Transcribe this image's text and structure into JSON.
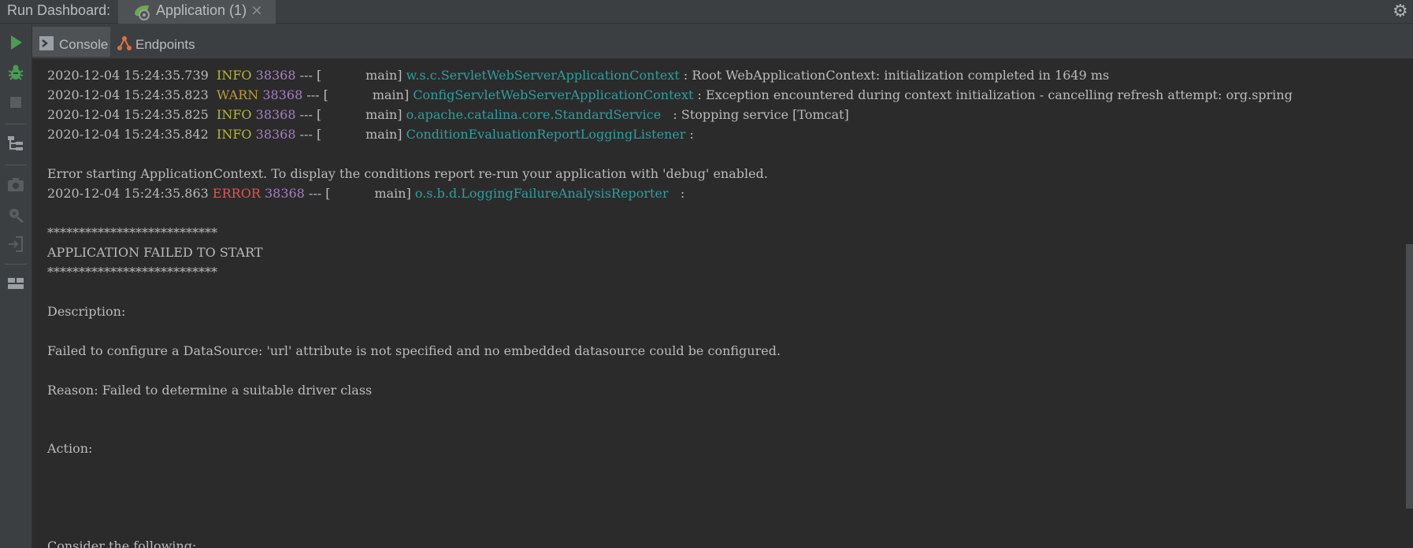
{
  "titlebar": {
    "title": "Run Dashboard:",
    "run_tab": "Application (1)",
    "close_glyph": "×",
    "icons": {
      "tab": "spring-boot-app-icon",
      "settings": "gear-icon"
    }
  },
  "toolbar": {
    "icons": [
      "run-icon",
      "debug-icon",
      "stop-icon",
      "tree-icon",
      "screenshot-icon",
      "settings-bug-icon",
      "login-icon",
      "layout-icon"
    ]
  },
  "console_tabs": [
    {
      "label": "Console",
      "icon": "console-icon",
      "active": true
    },
    {
      "label": "Endpoints",
      "icon": "endpoints-icon",
      "active": false
    }
  ],
  "colors": {
    "info": "#b6b63a",
    "warn": "#bb9c35",
    "error": "#e05555",
    "pid": "#a67fc4",
    "logger": "#2f9e9e",
    "text": "#bbbbbb"
  },
  "log_entries": [
    {
      "ts": "2020-12-04 15:24:35.739",
      "level": " INFO",
      "pid": "38368",
      "thread": " --- [           main] ",
      "logger": "w.s.c.ServletWebServerApplicationContext",
      "msg": " : Root WebApplicationContext: initialization completed in 1649 ms"
    },
    {
      "ts": "2020-12-04 15:24:35.823",
      "level": " WARN",
      "pid": "38368",
      "thread": " --- [           main] ",
      "logger": "ConfigServletWebServerApplicationContext",
      "msg": " : Exception encountered during context initialization - cancelling refresh attempt: org.spring"
    },
    {
      "ts": "2020-12-04 15:24:35.825",
      "level": " INFO",
      "pid": "38368",
      "thread": " --- [           main] ",
      "logger": "o.apache.catalina.core.StandardService  ",
      "msg": " : Stopping service [Tomcat]"
    },
    {
      "ts": "2020-12-04 15:24:35.842",
      "level": " INFO",
      "pid": "38368",
      "thread": " --- [           main] ",
      "logger": "ConditionEvaluationReportLoggingListener",
      "msg": " :"
    },
    {
      "ts": "2020-12-04 15:24:35.863",
      "level": "ERROR",
      "pid": "38368",
      "thread": " --- [           main] ",
      "logger": "o.s.b.d.LoggingFailureAnalysisReporter  ",
      "msg": " :"
    }
  ],
  "messages": {
    "error_starting": "Error starting ApplicationContext. To display the conditions report re-run your application with 'debug' enabled.",
    "stars": "***************************",
    "failed_title": "APPLICATION FAILED TO START",
    "description_label": "Description:",
    "description_text": "Failed to configure a DataSource: 'url' attribute is not specified and no embedded datasource could be configured.",
    "reason_text": "Reason: Failed to determine a suitable driver class",
    "action_label": "Action:",
    "consider_text": "Consider the following:"
  }
}
